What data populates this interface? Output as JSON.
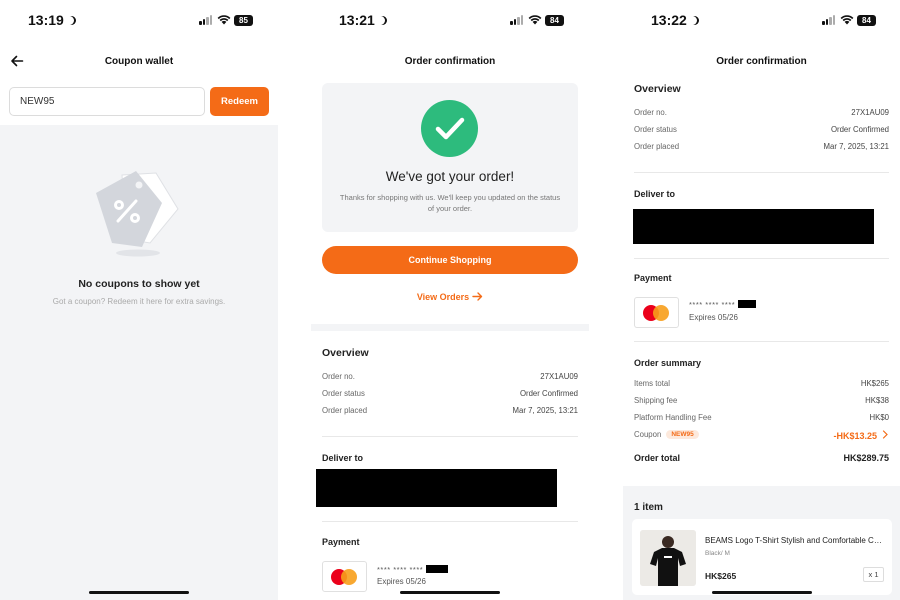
{
  "screens": {
    "wallet": {
      "status": {
        "time": "13:19",
        "battery": "85"
      },
      "title": "Coupon wallet",
      "coupon_input_value": "NEW95",
      "redeem_label": "Redeem",
      "empty_title": "No coupons to show yet",
      "empty_subtitle": "Got a coupon? Redeem it here for extra savings."
    },
    "confirm": {
      "status": {
        "time": "13:21",
        "battery": "84"
      },
      "title": "Order confirmation",
      "heading": "We've got your order!",
      "message": "Thanks for shopping with us. We'll keep you updated on the status of your order.",
      "continue_label": "Continue Shopping",
      "view_orders_label": "View Orders",
      "overview_title": "Overview",
      "rows": [
        {
          "label": "Order no.",
          "value": "27X1AU09"
        },
        {
          "label": "Order status",
          "value": "Order Confirmed"
        },
        {
          "label": "Order placed",
          "value": "Mar 7, 2025, 13:21"
        }
      ],
      "deliver_title": "Deliver to",
      "payment_title": "Payment",
      "card_number": "**** **** ****",
      "card_expiry": "Expires 05/26"
    },
    "details": {
      "status": {
        "time": "13:22",
        "battery": "84"
      },
      "title": "Order confirmation",
      "overview_title": "Overview",
      "rows": [
        {
          "label": "Order no.",
          "value": "27X1AU09"
        },
        {
          "label": "Order status",
          "value": "Order Confirmed"
        },
        {
          "label": "Order placed",
          "value": "Mar 7, 2025, 13:21"
        }
      ],
      "deliver_title": "Deliver to",
      "payment_title": "Payment",
      "card_number": "**** **** ****",
      "card_expiry": "Expires 05/26",
      "summary_title": "Order summary",
      "summary": {
        "items_total_label": "Items total",
        "items_total": "HK$265",
        "shipping_label": "Shipping fee",
        "shipping": "HK$38",
        "platform_label": "Platform Handling Fee",
        "platform": "HK$0",
        "coupon_label": "Coupon",
        "coupon_code": "NEW95",
        "coupon_value": "-HK$13.25",
        "total_label": "Order total",
        "total": "HK$289.75"
      },
      "items_title": "1 item",
      "item": {
        "name": "BEAMS Logo T-Shirt Stylish and Comfortable Cotton",
        "variant": "Black/ M",
        "price": "HK$265",
        "qty": "x 1"
      }
    }
  },
  "colors": {
    "accent": "#f46b17",
    "success": "#2dbb7d",
    "surface": "#f3f4f6"
  },
  "icons": [
    "back-arrow-icon",
    "coupon-tag-icon",
    "checkmark-icon",
    "arrow-right-icon",
    "chevron-right-icon",
    "mastercard-icon",
    "wifi-icon",
    "signal-icon",
    "battery-icon",
    "moon-icon"
  ]
}
